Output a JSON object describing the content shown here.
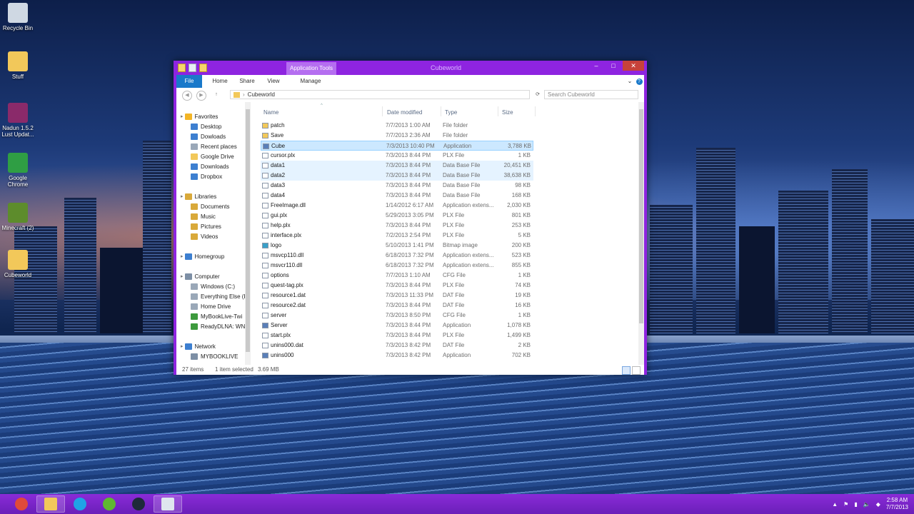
{
  "desktop": {
    "icons": [
      {
        "label": "Recycle Bin",
        "name": "recycle-bin-icon",
        "color": "#cfd8e3"
      },
      {
        "label": "Stuff",
        "name": "folder-icon",
        "color": "#f2c85a"
      },
      {
        "label": "Nadun 1.5.2 Lust Updat...",
        "name": "winrar-icon",
        "color": "#8a2a6a"
      },
      {
        "label": "Google Chrome",
        "name": "chrome-icon",
        "color": "#2f9e44"
      },
      {
        "label": "Minecraft (2)",
        "name": "minecraft-icon",
        "color": "#5d8c2c"
      },
      {
        "label": "Cubeworld",
        "name": "folder-icon",
        "color": "#f2c85a"
      }
    ]
  },
  "window": {
    "title": "Cubeworld",
    "context_tab": "Application Tools",
    "ribbon_tabs": [
      "File",
      "Home",
      "Share",
      "View",
      "Manage"
    ],
    "address": "Cubeworld",
    "search_placeholder": "Search Cubeworld",
    "min_glyph": "–",
    "max_glyph": "□",
    "close_glyph": "✕"
  },
  "nav": {
    "items": [
      {
        "label": "Favorites",
        "level": 0,
        "color": "#f3b526"
      },
      {
        "label": "Desktop",
        "level": 1,
        "color": "#3d7fd0"
      },
      {
        "label": "Dowloads",
        "level": 1,
        "color": "#3d7fd0"
      },
      {
        "label": "Recent places",
        "level": 1,
        "color": "#9aa8b8"
      },
      {
        "label": "Google Drive",
        "level": 1,
        "color": "#f2c85a"
      },
      {
        "label": "Downloads",
        "level": 1,
        "color": "#3d7fd0"
      },
      {
        "label": "Dropbox",
        "level": 1,
        "color": "#3d7fd0"
      },
      {
        "label": "Libraries",
        "level": 0,
        "color": "#d9a93a"
      },
      {
        "label": "Documents",
        "level": 1,
        "color": "#d9a93a"
      },
      {
        "label": "Music",
        "level": 1,
        "color": "#d9a93a"
      },
      {
        "label": "Pictures",
        "level": 1,
        "color": "#d9a93a"
      },
      {
        "label": "Videos",
        "level": 1,
        "color": "#d9a93a"
      },
      {
        "label": "Homegroup",
        "level": 0,
        "color": "#3d7fd0"
      },
      {
        "label": "Computer",
        "level": 0,
        "color": "#7d8fa5"
      },
      {
        "label": "Windows (C:)",
        "level": 1,
        "color": "#9aa8b8"
      },
      {
        "label": "Everything Else (E",
        "level": 1,
        "color": "#9aa8b8"
      },
      {
        "label": "Home Drive",
        "level": 1,
        "color": "#9aa8b8"
      },
      {
        "label": "MyBookLive-Twi",
        "level": 1,
        "color": "#3d9a3d"
      },
      {
        "label": "ReadyDLNA: WN",
        "level": 1,
        "color": "#3d9a3d"
      },
      {
        "label": "Network",
        "level": 0,
        "color": "#3d7fd0"
      },
      {
        "label": "MYBOOKLIVE",
        "level": 1,
        "color": "#7d8fa5"
      }
    ]
  },
  "columns": [
    "Name",
    "Date modified",
    "Type",
    "Size"
  ],
  "files": [
    {
      "name": "patch",
      "date": "7/7/2013 1:00 AM",
      "type": "File folder",
      "size": "",
      "kind": "folder",
      "state": ""
    },
    {
      "name": "Save",
      "date": "7/7/2013 2:36 AM",
      "type": "File folder",
      "size": "",
      "kind": "folder",
      "state": ""
    },
    {
      "name": "Cube",
      "date": "7/3/2013 10:40 PM",
      "type": "Application",
      "size": "3,788 KB",
      "kind": "app",
      "state": "sel"
    },
    {
      "name": "cursor.plx",
      "date": "7/3/2013 8:44 PM",
      "type": "PLX File",
      "size": "1 KB",
      "kind": "file",
      "state": ""
    },
    {
      "name": "data1",
      "date": "7/3/2013 8:44 PM",
      "type": "Data Base File",
      "size": "20,451 KB",
      "kind": "file",
      "state": "hover"
    },
    {
      "name": "data2",
      "date": "7/3/2013 8:44 PM",
      "type": "Data Base File",
      "size": "38,638 KB",
      "kind": "file",
      "state": "hover"
    },
    {
      "name": "data3",
      "date": "7/3/2013 8:44 PM",
      "type": "Data Base File",
      "size": "98 KB",
      "kind": "file",
      "state": ""
    },
    {
      "name": "data4",
      "date": "7/3/2013 8:44 PM",
      "type": "Data Base File",
      "size": "168 KB",
      "kind": "file",
      "state": ""
    },
    {
      "name": "FreeImage.dll",
      "date": "1/14/2012 6:17 AM",
      "type": "Application extens...",
      "size": "2,030 KB",
      "kind": "file",
      "state": ""
    },
    {
      "name": "gui.plx",
      "date": "5/29/2013 3:05 PM",
      "type": "PLX File",
      "size": "801 KB",
      "kind": "file",
      "state": ""
    },
    {
      "name": "help.plx",
      "date": "7/3/2013 8:44 PM",
      "type": "PLX File",
      "size": "253 KB",
      "kind": "file",
      "state": ""
    },
    {
      "name": "interface.plx",
      "date": "7/2/2013 2:54 PM",
      "type": "PLX File",
      "size": "5 KB",
      "kind": "file",
      "state": ""
    },
    {
      "name": "logo",
      "date": "5/10/2013 1:41 PM",
      "type": "Bitmap image",
      "size": "200 KB",
      "kind": "image",
      "state": ""
    },
    {
      "name": "msvcp110.dll",
      "date": "6/18/2013 7:32 PM",
      "type": "Application extens...",
      "size": "523 KB",
      "kind": "file",
      "state": ""
    },
    {
      "name": "msvcr110.dll",
      "date": "6/18/2013 7:32 PM",
      "type": "Application extens...",
      "size": "855 KB",
      "kind": "file",
      "state": ""
    },
    {
      "name": "options",
      "date": "7/7/2013 1:10 AM",
      "type": "CFG File",
      "size": "1 KB",
      "kind": "file",
      "state": ""
    },
    {
      "name": "quest-tag.plx",
      "date": "7/3/2013 8:44 PM",
      "type": "PLX File",
      "size": "74 KB",
      "kind": "file",
      "state": ""
    },
    {
      "name": "resource1.dat",
      "date": "7/3/2013 11:33 PM",
      "type": "DAT File",
      "size": "19 KB",
      "kind": "file",
      "state": ""
    },
    {
      "name": "resource2.dat",
      "date": "7/3/2013 8:44 PM",
      "type": "DAT File",
      "size": "16 KB",
      "kind": "file",
      "state": ""
    },
    {
      "name": "server",
      "date": "7/3/2013 8:50 PM",
      "type": "CFG File",
      "size": "1 KB",
      "kind": "file",
      "state": ""
    },
    {
      "name": "Server",
      "date": "7/3/2013 8:44 PM",
      "type": "Application",
      "size": "1,078 KB",
      "kind": "app",
      "state": ""
    },
    {
      "name": "start.plx",
      "date": "7/3/2013 8:44 PM",
      "type": "PLX File",
      "size": "1,499 KB",
      "kind": "file",
      "state": ""
    },
    {
      "name": "unins000.dat",
      "date": "7/3/2013 8:42 PM",
      "type": "DAT File",
      "size": "2 KB",
      "kind": "file",
      "state": ""
    },
    {
      "name": "unins000",
      "date": "7/3/2013 8:42 PM",
      "type": "Application",
      "size": "702 KB",
      "kind": "app",
      "state": ""
    }
  ],
  "status": {
    "items": "27 items",
    "selected": "1 item selected",
    "size": "3.69 MB"
  },
  "taskbar": {
    "apps": [
      {
        "name": "chrome-icon",
        "color": "#e04a3a",
        "active": false
      },
      {
        "name": "file-explorer-icon",
        "color": "#f2c85a",
        "active": true
      },
      {
        "name": "skype-icon",
        "color": "#1fa3e6",
        "active": false
      },
      {
        "name": "spotify-icon",
        "color": "#5fb830",
        "active": false
      },
      {
        "name": "steam-icon",
        "color": "#1e2a3a",
        "active": false
      },
      {
        "name": "window-icon",
        "color": "#dfe6ee",
        "active": true
      }
    ],
    "time": "2:58 AM",
    "date": "7/7/2013"
  }
}
